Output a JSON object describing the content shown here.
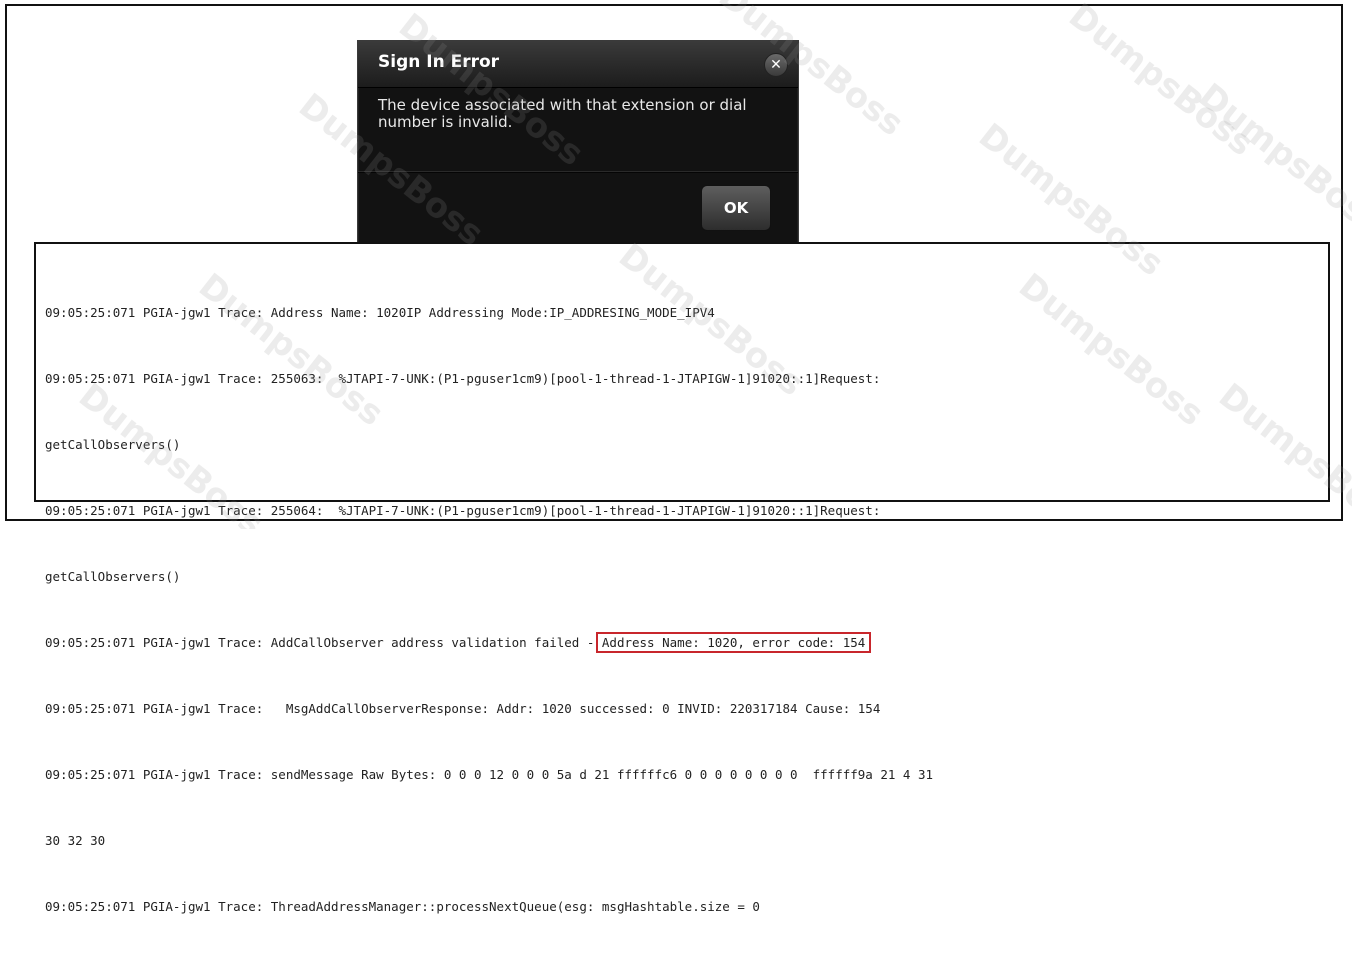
{
  "dialog": {
    "title": "Sign In Error",
    "close_icon": "close-icon",
    "message": "The device associated with that extension or dial number is invalid.",
    "ok_label": "OK"
  },
  "log": {
    "lines": [
      "09:05:25:071 PGIA-jgw1 Trace: Address Name: 1020IP Addressing Mode:IP_ADDRESING_MODE_IPV4",
      "09:05:25:071 PGIA-jgw1 Trace: 255063:  %JTAPI-7-UNK:(P1-pguser1cm9)[pool-1-thread-1-JTAPIGW-1]91020::1]Request:",
      "getCallObservers()",
      "09:05:25:071 PGIA-jgw1 Trace: 255064:  %JTAPI-7-UNK:(P1-pguser1cm9)[pool-1-thread-1-JTAPIGW-1]91020::1]Request:",
      "getCallObservers()",
      "09:05:25:071 PGIA-jgw1 Trace: AddCallObserver address validation failed - ",
      "09:05:25:071 PGIA-jgw1 Trace:   MsgAddCallObserverResponse: Addr: 1020 successed: 0 INVID: 220317184 Cause: 154",
      "09:05:25:071 PGIA-jgw1 Trace: sendMessage Raw Bytes: 0 0 0 12 0 0 0 5a d 21 ffffffc6 0 0 0 0 0 0 0 0  ffffff9a 21 4 31",
      "30 32 30",
      "09:05:25:071 PGIA-jgw1 Trace: ThreadAddressManager::processNextQueue(esg: msgHashtable.size = 0"
    ],
    "highlighted_text": "Address Name: 1020, error code: 154"
  },
  "watermark_text": "DumpsBoss",
  "colors": {
    "highlight_border": "#c8262c",
    "dialog_bg": "#121212"
  }
}
